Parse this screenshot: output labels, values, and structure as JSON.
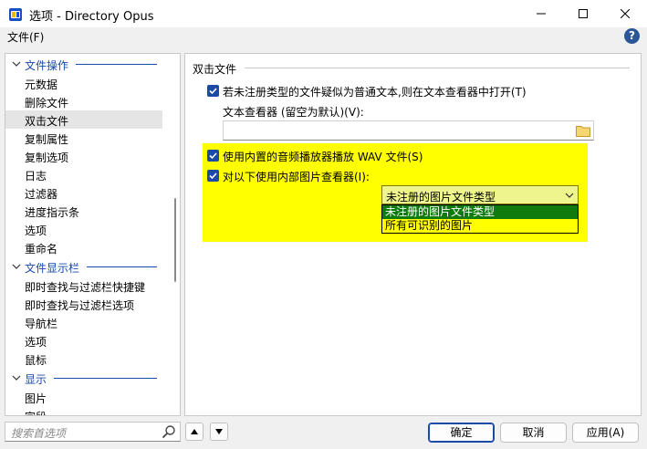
{
  "window": {
    "title": "选项 - Directory Opus",
    "icons": {
      "minimize": "minimize-icon",
      "maximize": "maximize-icon",
      "close": "close-icon",
      "app": "directory-opus-icon"
    }
  },
  "menu": {
    "file": "文件(F)",
    "help_icon": "help-icon",
    "help_glyph": "?"
  },
  "tree": {
    "items": [
      {
        "label": "文件操作",
        "type": "category"
      },
      {
        "label": "元数据",
        "type": "item"
      },
      {
        "label": "删除文件",
        "type": "item"
      },
      {
        "label": "双击文件",
        "type": "item",
        "selected": true
      },
      {
        "label": "复制属性",
        "type": "item"
      },
      {
        "label": "复制选项",
        "type": "item"
      },
      {
        "label": "日志",
        "type": "item"
      },
      {
        "label": "过滤器",
        "type": "item"
      },
      {
        "label": "进度指示条",
        "type": "item"
      },
      {
        "label": "选项",
        "type": "item"
      },
      {
        "label": "重命名",
        "type": "item"
      },
      {
        "label": "文件显示栏",
        "type": "category"
      },
      {
        "label": "即时查找与过滤栏快捷键",
        "type": "item"
      },
      {
        "label": "即时查找与过滤栏选项",
        "type": "item"
      },
      {
        "label": "导航栏",
        "type": "item"
      },
      {
        "label": "选项",
        "type": "item"
      },
      {
        "label": "鼠标",
        "type": "item"
      },
      {
        "label": "显示",
        "type": "category"
      },
      {
        "label": "图片",
        "type": "item"
      },
      {
        "label": "字段",
        "type": "item"
      }
    ]
  },
  "panel": {
    "section_title": "双击文件",
    "opt_plaintext": {
      "label": "若未注册类型的文件疑似为普通文本,则在文本查看器中打开(T)",
      "checked": true
    },
    "viewer_label": "文本查看器 (留空为默认)(V):",
    "viewer_value": "",
    "opt_wav": {
      "label": "使用内置的音频播放器播放 WAV 文件(S)",
      "checked": true
    },
    "opt_image": {
      "label": "对以下使用内部图片查看器(I):",
      "checked": true
    },
    "combo": {
      "selected": "未注册的图片文件类型",
      "options": [
        "未注册的图片文件类型",
        "所有可识别的图片"
      ]
    },
    "highlight_color": "#ffff00",
    "selection_color": "#0f7b0f"
  },
  "footer": {
    "search_placeholder": "搜索首选项",
    "ok": "确定",
    "cancel": "取消",
    "apply": "应用(A)"
  }
}
